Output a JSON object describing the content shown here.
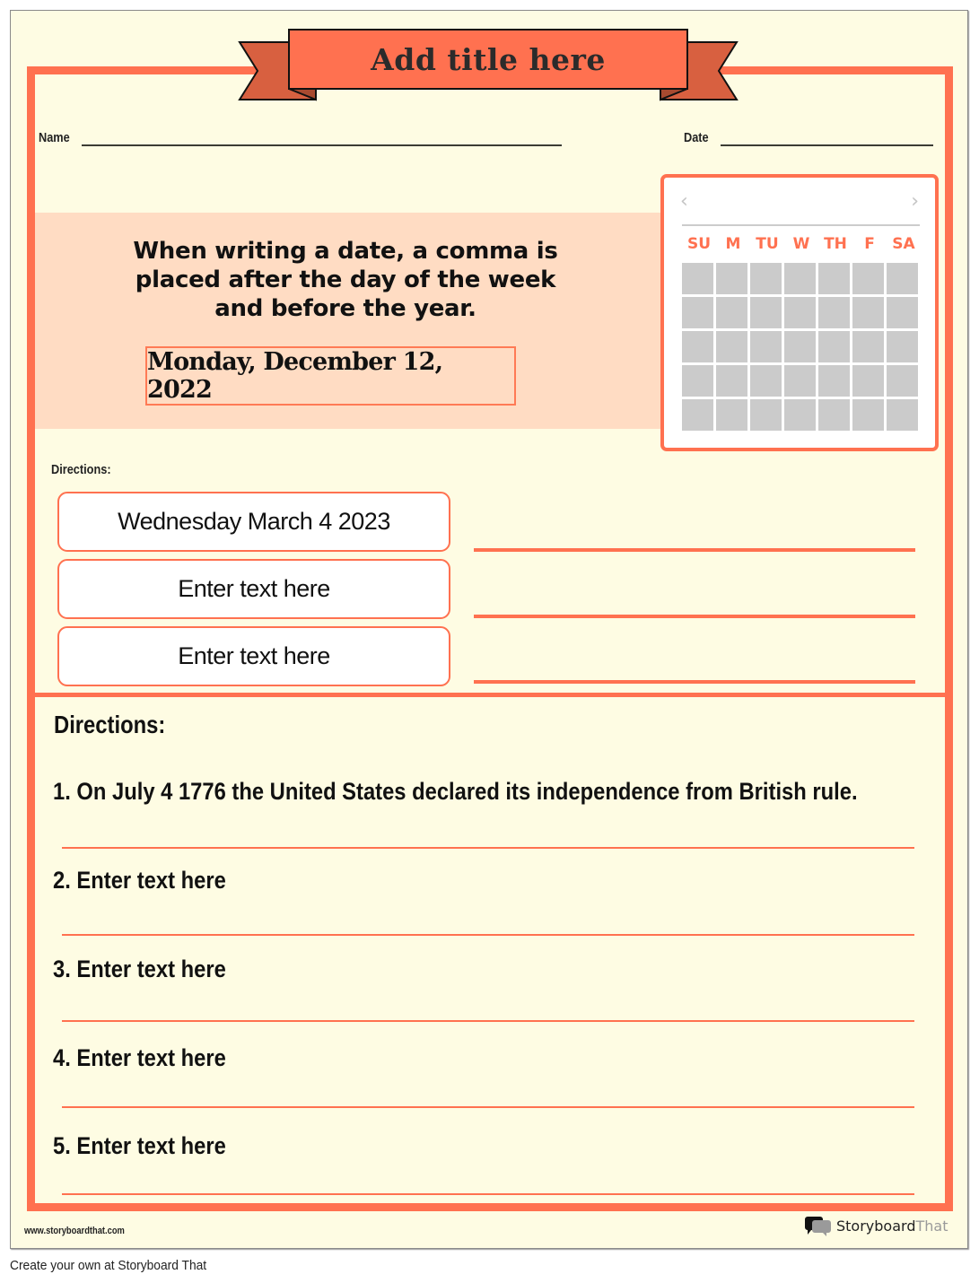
{
  "worksheet": {
    "title": "Add title here",
    "name_label": "Name",
    "date_label": "Date",
    "colors": {
      "accent": "#ff7150",
      "ribbon_tail": "#d86040",
      "paper": "#fefce3",
      "info_box": "#ffdcc3",
      "calendar_cell": "#cbcbcb"
    }
  },
  "info": {
    "rule_line1": "When writing a date, a comma is",
    "rule_line2": "placed after the day of the week",
    "rule_line3": "and before the year.",
    "example": "Monday, December 12, 2022"
  },
  "calendar": {
    "prev_icon": "chevron-left",
    "next_icon": "chevron-right",
    "days": [
      "SU",
      "M",
      "TU",
      "W",
      "TH",
      "F",
      "SA"
    ],
    "rows": 5
  },
  "section1": {
    "heading": "Directions:",
    "items": [
      {
        "text": "Wednesday March 4 2023"
      },
      {
        "text": "Enter text here"
      },
      {
        "text": "Enter text here"
      }
    ]
  },
  "section2": {
    "heading": "Directions:",
    "items": [
      {
        "text": "1. On July 4 1776 the United States declared its independence from British rule."
      },
      {
        "text": "2. Enter text here"
      },
      {
        "text": "3. Enter text here"
      },
      {
        "text": "4. Enter text here"
      },
      {
        "text": "5. Enter text here"
      }
    ]
  },
  "footer": {
    "url": "www.storyboardthat.com",
    "logo_main": "Storyboard",
    "logo_accent": "That",
    "create_line": "Create your own at Storyboard That"
  }
}
